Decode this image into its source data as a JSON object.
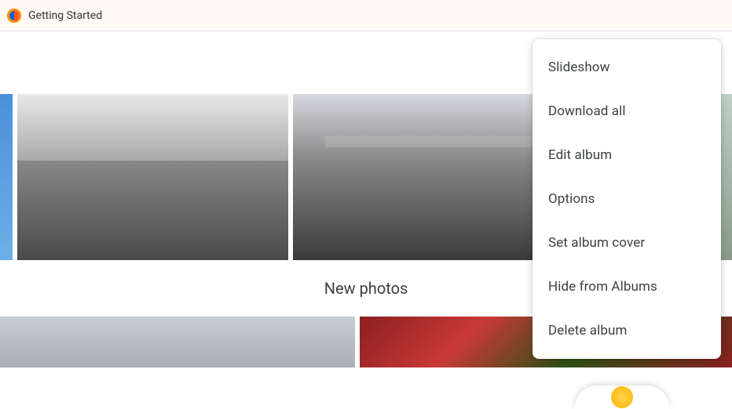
{
  "browser": {
    "tab_title": "Getting Started"
  },
  "toolbar": {
    "shop_icon": "shopping-bag"
  },
  "section": {
    "title": "New photos"
  },
  "context_menu": {
    "items": [
      "Slideshow",
      "Download all",
      "Edit album",
      "Options",
      "Set album cover",
      "Hide from Albums",
      "Delete album"
    ]
  }
}
